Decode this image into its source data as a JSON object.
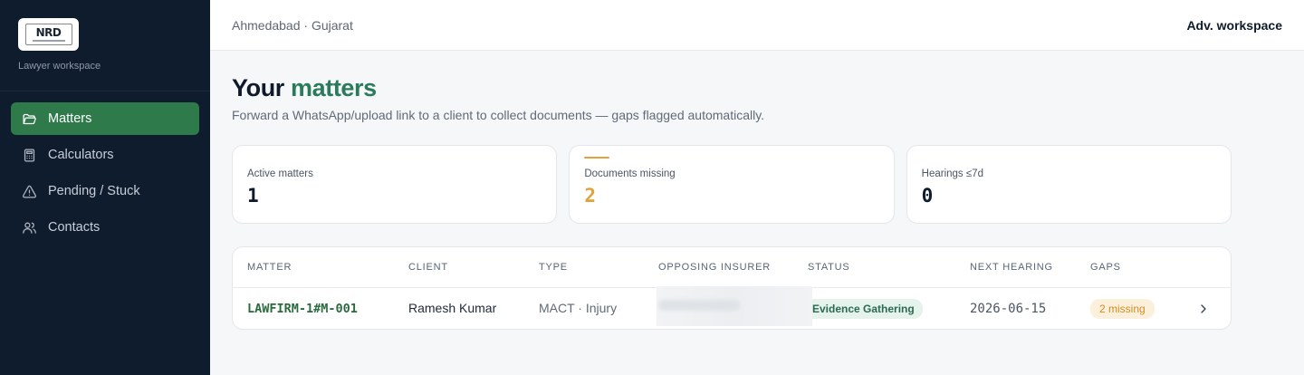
{
  "brand": {
    "logo_text": "NRD",
    "caption": "Lawyer workspace"
  },
  "sidebar": {
    "items": [
      {
        "label": "Matters",
        "icon": "folder-open-icon",
        "active": true
      },
      {
        "label": "Calculators",
        "icon": "calculator-icon",
        "active": false
      },
      {
        "label": "Pending / Stuck",
        "icon": "warning-triangle-icon",
        "active": false
      },
      {
        "label": "Contacts",
        "icon": "users-icon",
        "active": false
      }
    ]
  },
  "topbar": {
    "location": "Ahmedabad · Gujarat",
    "workspace": "Adv. workspace"
  },
  "page": {
    "title_part1": "Your",
    "title_part2": "matters",
    "subtitle": "Forward a WhatsApp/upload link to a client to collect documents — gaps flagged automatically."
  },
  "stats": [
    {
      "label": "Active matters",
      "value": "1"
    },
    {
      "label": "Documents missing",
      "value": "2"
    },
    {
      "label": "Hearings ≤7d",
      "value": "0"
    }
  ],
  "table": {
    "headers": [
      "Matter",
      "Client",
      "Type",
      "Opposing insurer",
      "Status",
      "Next hearing",
      "Gaps"
    ],
    "rows": [
      {
        "matter": "LAWFIRM-1#M-001",
        "client": "Ramesh Kumar",
        "type": "MACT · Injury",
        "status": "Evidence Gathering",
        "next_hearing": "2026-06-15",
        "gaps": "2 missing"
      }
    ]
  },
  "colors": {
    "sidebar_bg": "#0f1c2d",
    "active_nav": "#2f7a4b",
    "accent_green": "#2a7a5c",
    "warning": "#e2a23b"
  }
}
